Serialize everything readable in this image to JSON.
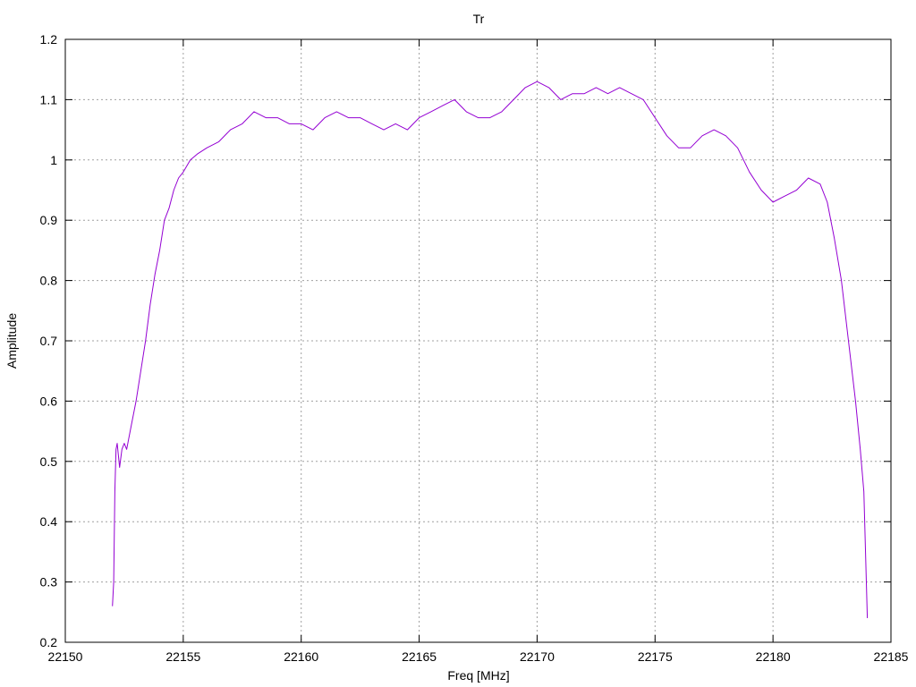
{
  "chart_data": {
    "type": "line",
    "title": "Tr",
    "xlabel": "Freq [MHz]",
    "ylabel": "Amplitude",
    "xlim": [
      22150,
      22185
    ],
    "ylim": [
      0.2,
      1.2
    ],
    "xticks": [
      22150,
      22155,
      22160,
      22165,
      22170,
      22175,
      22180,
      22185
    ],
    "yticks": [
      0.2,
      0.3,
      0.4,
      0.5,
      0.6,
      0.7,
      0.8,
      0.9,
      1,
      1.1,
      1.2
    ],
    "xtick_labels": [
      "22150",
      "22155",
      "22160",
      "22165",
      "22170",
      "22175",
      "22180",
      "22185"
    ],
    "ytick_labels": [
      "0.2",
      "0.3",
      "0.4",
      "0.5",
      "0.6",
      "0.7",
      "0.8",
      "0.9",
      "1",
      "1.1",
      "1.2"
    ],
    "grid": true,
    "series": [
      {
        "color": "#9400d3",
        "x": [
          22152.0,
          22152.05,
          22152.1,
          22152.15,
          22152.2,
          22152.3,
          22152.4,
          22152.5,
          22152.6,
          22152.8,
          22153.0,
          22153.2,
          22153.4,
          22153.6,
          22153.8,
          22154.0,
          22154.2,
          22154.4,
          22154.6,
          22154.8,
          22155.0,
          22155.3,
          22155.6,
          22156.0,
          22156.5,
          22157.0,
          22157.5,
          22158.0,
          22158.5,
          22159.0,
          22159.5,
          22160.0,
          22160.5,
          22161.0,
          22161.5,
          22162.0,
          22162.5,
          22163.0,
          22163.5,
          22164.0,
          22164.5,
          22165.0,
          22165.5,
          22166.0,
          22166.5,
          22167.0,
          22167.5,
          22168.0,
          22168.5,
          22169.0,
          22169.5,
          22170.0,
          22170.5,
          22171.0,
          22171.5,
          22172.0,
          22172.5,
          22173.0,
          22173.5,
          22174.0,
          22174.5,
          22175.0,
          22175.5,
          22176.0,
          22176.5,
          22177.0,
          22177.5,
          22178.0,
          22178.5,
          22179.0,
          22179.5,
          22180.0,
          22180.5,
          22181.0,
          22181.5,
          22182.0,
          22182.3,
          22182.6,
          22182.9,
          22183.2,
          22183.5,
          22183.7,
          22183.85,
          22184.0
        ],
        "y": [
          0.26,
          0.3,
          0.45,
          0.52,
          0.53,
          0.49,
          0.52,
          0.53,
          0.52,
          0.56,
          0.6,
          0.65,
          0.7,
          0.76,
          0.81,
          0.85,
          0.9,
          0.92,
          0.95,
          0.97,
          0.98,
          1.0,
          1.01,
          1.02,
          1.03,
          1.05,
          1.06,
          1.08,
          1.07,
          1.07,
          1.06,
          1.06,
          1.05,
          1.07,
          1.08,
          1.07,
          1.07,
          1.06,
          1.05,
          1.06,
          1.05,
          1.07,
          1.08,
          1.09,
          1.1,
          1.08,
          1.07,
          1.07,
          1.08,
          1.1,
          1.12,
          1.13,
          1.12,
          1.1,
          1.11,
          1.11,
          1.12,
          1.11,
          1.12,
          1.11,
          1.1,
          1.07,
          1.04,
          1.02,
          1.02,
          1.04,
          1.05,
          1.04,
          1.02,
          0.98,
          0.95,
          0.93,
          0.94,
          0.95,
          0.97,
          0.96,
          0.93,
          0.87,
          0.8,
          0.7,
          0.6,
          0.52,
          0.45,
          0.24
        ]
      }
    ]
  }
}
